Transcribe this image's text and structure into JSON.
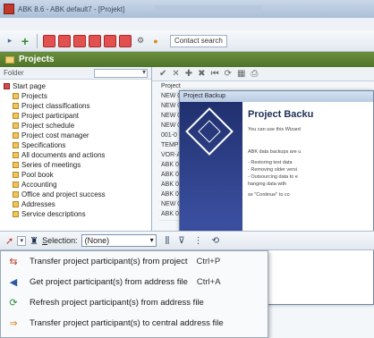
{
  "window": {
    "title": "ABK 8.6 - ABK default7 - [Projekt]"
  },
  "toolbar": {
    "search_value": "Contact search"
  },
  "projects_panel": {
    "title": "Projects",
    "folder_label": "Folder"
  },
  "tree": {
    "items": [
      {
        "label": "Start page",
        "icon": "start-icon"
      },
      {
        "label": "Projects",
        "icon": "folder-icon"
      },
      {
        "label": "Project classifications",
        "icon": "folder-icon"
      },
      {
        "label": "Project participant",
        "icon": "folder-icon"
      },
      {
        "label": "Project schedule",
        "icon": "folder-icon"
      },
      {
        "label": "Project cost manager",
        "icon": "folder-icon"
      },
      {
        "label": "Specifications",
        "icon": "folder-icon"
      },
      {
        "label": "All documents and actions",
        "icon": "folder-icon"
      },
      {
        "label": "Series of meetings",
        "icon": "folder-icon"
      },
      {
        "label": "Pool book",
        "icon": "folder-icon"
      },
      {
        "label": "Accounting",
        "icon": "folder-icon"
      },
      {
        "label": "Office and project success",
        "icon": "folder-icon"
      },
      {
        "label": "Addresses",
        "icon": "folder-icon"
      },
      {
        "label": "Service descriptions",
        "icon": "folder-icon"
      }
    ]
  },
  "list": {
    "rows": [
      "Project",
      "NEW 0",
      "NEW 0",
      "NEW 0",
      "NEW 0",
      "001-0",
      "TEMP",
      "VOR-A",
      "ABK 0",
      "ABK 0",
      "ABK 0",
      "ABK 0",
      "NEW 0",
      "ABK 0"
    ]
  },
  "dialog": {
    "title": "Project Backup",
    "heading": "Project Backu",
    "intro": "You can use this Wizard",
    "body_lines": [
      "ABK data backups are u",
      "- Restoring test data",
      "- Removing older versi",
      "- Outsourcing data to e",
      "  hanging data with",
      "se \"Continue\" to co"
    ]
  },
  "selection_toolbar": {
    "label_prefix": "S",
    "label_rest": "election:",
    "value": "(None)"
  },
  "context_menu": {
    "items": [
      {
        "label": "Transfer project participant(s) from project",
        "shortcut": "Ctrl+P",
        "icon": "transfer-from-project-icon"
      },
      {
        "label": "Get project participant(s) from address file",
        "shortcut": "Ctrl+A",
        "icon": "get-from-address-icon"
      },
      {
        "label": "Refresh project participant(s) from address file",
        "shortcut": "",
        "icon": "refresh-icon"
      },
      {
        "label": "Transfer project participant(s) to central address file",
        "shortcut": "",
        "icon": "transfer-to-central-icon"
      }
    ]
  }
}
